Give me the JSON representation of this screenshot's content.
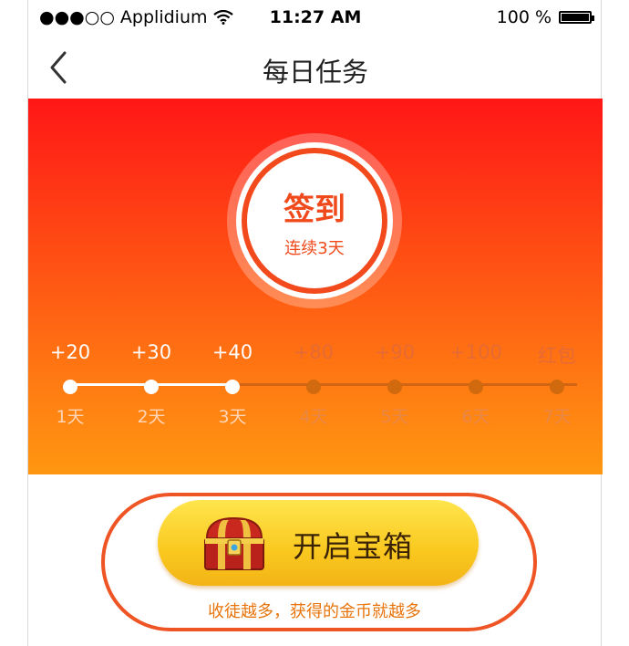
{
  "status_bar": {
    "carrier": "●●●○○ Applidium",
    "wifi_icon": "wifi-icon",
    "time": "11:27 AM",
    "battery_text": "100 %",
    "battery_level": 1.0
  },
  "nav": {
    "title": "每日任务",
    "back_icon": "chevron-left-icon"
  },
  "checkin": {
    "label": "签到",
    "streak": "连续3天"
  },
  "days": [
    {
      "reward": "+20",
      "label": "1天",
      "done": true
    },
    {
      "reward": "+30",
      "label": "2天",
      "done": true
    },
    {
      "reward": "+40",
      "label": "3天",
      "done": true
    },
    {
      "reward": "+80",
      "label": "4天",
      "done": false
    },
    {
      "reward": "+90",
      "label": "5天",
      "done": false
    },
    {
      "reward": "+100",
      "label": "6天",
      "done": false
    },
    {
      "reward": "红包",
      "label": "7天",
      "done": false
    }
  ],
  "treasure": {
    "button_label": "开启宝箱",
    "icon": "treasure-chest-icon",
    "hint": "收徒越多，获得的金币就越多"
  },
  "colors": {
    "accent": "#f04a1c",
    "gradient_top": "#ff1616",
    "gradient_bottom": "#ff9711",
    "button_yellow": "#f9c81f",
    "hint_orange": "#e8740c"
  }
}
